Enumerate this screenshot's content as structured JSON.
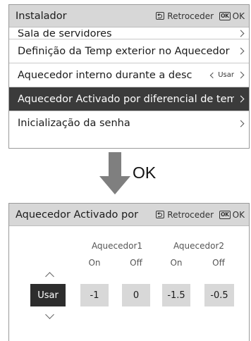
{
  "screen1": {
    "title": "Instalador",
    "back_label": "Retroceder",
    "ok_icon": "OK",
    "ok_label": "OK",
    "items": [
      {
        "label": "Sala de servidores"
      },
      {
        "label": "Definição da Temp exterior no Aquecedor"
      },
      {
        "label": "Aquecedor interno durante a desc",
        "value": "Usar"
      },
      {
        "label": "Aquecedor Activado por diferencial de temp"
      },
      {
        "label": "Inicialização da senha"
      }
    ],
    "selected_index": 3
  },
  "transition": {
    "label": "OK",
    "icon": "down-arrow-icon"
  },
  "screen2": {
    "title": "Aquecedor Activado por",
    "back_label": "Retroceder",
    "ok_icon": "OK",
    "ok_label": "OK",
    "groups": [
      {
        "name": "Aquecedor1",
        "cols": [
          "On",
          "Off"
        ],
        "values": [
          "-1",
          "0"
        ]
      },
      {
        "name": "Aquecedor2",
        "cols": [
          "On",
          "Off"
        ],
        "values": [
          "-1.5",
          "-0.5"
        ]
      }
    ],
    "selector_value": "Usar"
  },
  "colors": {
    "titlebar": "#d7d7d7",
    "selected_row": "#3b3b3b",
    "value_box": "#d8d8d8",
    "selector_box": "#2d2d2d",
    "arrow": "#7f7f7f"
  }
}
